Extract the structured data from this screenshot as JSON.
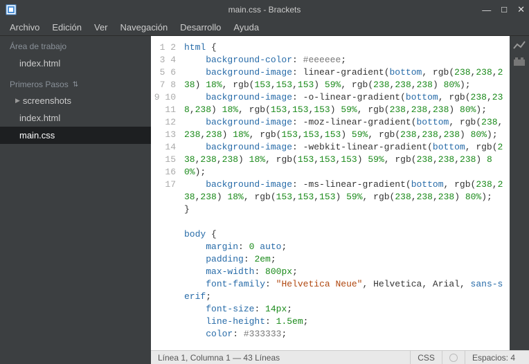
{
  "title": "main.css - Brackets",
  "menu": [
    "Archivo",
    "Edición",
    "Ver",
    "Navegación",
    "Desarrollo",
    "Ayuda"
  ],
  "workspace_label": "Área de trabajo",
  "workspace_files": [
    "index.html"
  ],
  "project_label": "Primeros Pasos",
  "project_tree": [
    {
      "label": "screenshots",
      "type": "folder"
    },
    {
      "label": "index.html",
      "type": "file"
    },
    {
      "label": "main.css",
      "type": "file",
      "active": true
    }
  ],
  "gutter": [
    "1",
    "2",
    "3",
    "",
    "",
    "4",
    "",
    "",
    "5",
    "",
    "",
    "6",
    "",
    "",
    "7",
    "",
    "",
    "8",
    "9",
    "10",
    "11",
    "12",
    "13",
    "14",
    "",
    "15",
    "16",
    "17"
  ],
  "status_left": "Línea 1, Columna 1 — 43 Líneas",
  "status_lang": "CSS",
  "status_spaces": "Espacios: 4",
  "code_tokens": {
    "html": "html",
    "body": "body",
    "open": " {",
    "close": "}",
    "bgcolor": "background-color",
    "bgimage": "background-image",
    "margin": "margin",
    "padding": "padding",
    "maxw": "max-width",
    "ff": "font-family",
    "fs": "font-size",
    "lh": "line-height",
    "color": "color",
    "hex_eee": "#eeeeee",
    "hex_333": "#333333",
    "lg": "linear-gradient",
    "olg": "-o-linear-gradient",
    "mlg": "-moz-linear-gradient",
    "wlg": "-webkit-linear-gradient",
    "mslg": "-ms-linear-gradient",
    "bottom": "bottom",
    "rgb": "rgb",
    "n238": "238",
    "n153": "153",
    "p18": "18%",
    "p59": "59%",
    "p80": "80%",
    "n0": "0",
    "auto": "auto",
    "em2": "2em",
    "px800": "800px",
    "px14": "14px",
    "em15": "1.5em",
    "hn": "\"Helvetica Neue\"",
    "hel": "Helvetica",
    "ari": "Arial",
    "ss": "sans-serif"
  },
  "chart_data": null
}
